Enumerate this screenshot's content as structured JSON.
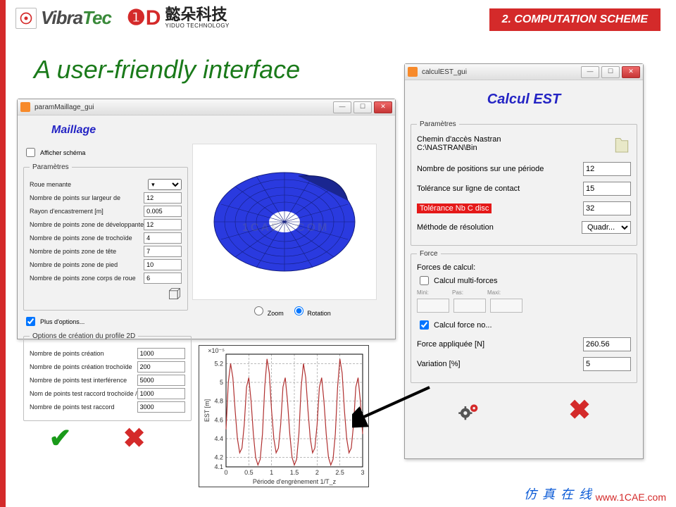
{
  "header": {
    "brand_a_dark": "Vibra",
    "brand_a_green": "Tec",
    "brand_b_cn": "懿朵科技",
    "brand_b_en": "YIDUO TECHNOLOGY",
    "scheme_label": "2. COMPUTATION SCHEME"
  },
  "slide_title": "A user-friendly interface",
  "win_maillage": {
    "title": "paramMaillage_gui",
    "heading": "Maillage",
    "cb_afficher": "Afficher schéma",
    "fs_params": "Paramètres",
    "roue_label": "Roue menante",
    "fields": [
      {
        "label": "Nombre de points sur largeur de",
        "value": "12"
      },
      {
        "label": "Rayon d'encastrement [m]",
        "value": "0.005"
      },
      {
        "label": "Nombre de points zone de développante",
        "value": "12"
      },
      {
        "label": "Nombre de points zone de trochoïde",
        "value": "4"
      },
      {
        "label": "Nombre de points zone de tête",
        "value": "7"
      },
      {
        "label": "Nombre de points zone de pied",
        "value": "10"
      },
      {
        "label": "Nombre de points zone corps de roue",
        "value": "6"
      }
    ],
    "cb_plus": "Plus d'options...",
    "fs_options": "Options de création du profile 2D",
    "fields2": [
      {
        "label": "Nombre de points création",
        "value": "1000"
      },
      {
        "label": "Nombre de points création trochoïde",
        "value": "200"
      },
      {
        "label": "Nombre de points test interférence",
        "value": "5000"
      },
      {
        "label": "Nom de points test raccord trochoïde /",
        "value": "1000"
      },
      {
        "label": "Nombre de points test raccord",
        "value": "3000"
      }
    ],
    "radio_zoom": "Zoom",
    "radio_rotation": "Rotation"
  },
  "win_calc": {
    "title": "calculEST_gui",
    "heading": "Calcul EST",
    "fs_params": "Paramètres",
    "chemin_l1": "Chemin d'accès Nastran",
    "chemin_l2": "C:\\NASTRAN\\Bin",
    "f_positions_label": "Nombre de positions sur une période",
    "f_positions_value": "12",
    "f_tol_label": "Tolérance sur ligne de contact",
    "f_tol_value": "15",
    "f_tol_nb_label": "Tolérance Nb C disc",
    "f_tol_nb_value": "32",
    "f_method_label": "Méthode de résolution",
    "f_method_value": "Quadr...",
    "fs_force": "Force",
    "forces_heading": "Forces de calcul:",
    "cb_multi": "Calcul multi-forces",
    "mini": "Mini:",
    "pas": "Pas:",
    "maxi": "Maxi:",
    "cb_force_no": "Calcul force no...",
    "force_app_label": "Force appliquée [N]",
    "force_app_value": "260.56",
    "var_label": "Variation [%]",
    "var_value": "5"
  },
  "chart_data": {
    "type": "line",
    "title": "",
    "xlabel": "Période d'engrènement 1/T_z",
    "ylabel": "EST [m]",
    "y_exponent": "×10⁻⁵",
    "xlim": [
      0,
      3
    ],
    "ylim": [
      4.1,
      5.3
    ],
    "xticks": [
      0,
      0.5,
      1,
      1.5,
      2,
      2.5,
      3
    ],
    "yticks": [
      4.1,
      4.2,
      4.4,
      4.6,
      4.8,
      5.0,
      5.2
    ],
    "x": [
      0.0,
      0.05,
      0.1,
      0.15,
      0.2,
      0.25,
      0.3,
      0.35,
      0.4,
      0.45,
      0.5,
      0.55,
      0.6,
      0.65,
      0.7,
      0.75,
      0.8,
      0.85,
      0.9,
      0.95,
      1.0,
      1.05,
      1.1,
      1.15,
      1.2,
      1.25,
      1.3,
      1.35,
      1.4,
      1.45,
      1.5,
      1.55,
      1.6,
      1.65,
      1.7,
      1.75,
      1.8,
      1.85,
      1.9,
      1.95,
      2.0,
      2.05,
      2.1,
      2.15,
      2.2,
      2.25,
      2.3,
      2.35,
      2.4,
      2.45,
      2.5,
      2.55,
      2.6,
      2.65,
      2.7,
      2.75,
      2.8,
      2.85,
      2.9,
      2.95,
      3.0
    ],
    "y": [
      4.5,
      5.0,
      5.2,
      5.05,
      4.7,
      4.4,
      4.25,
      4.3,
      4.55,
      4.95,
      5.05,
      4.8,
      4.45,
      4.2,
      4.12,
      4.18,
      4.45,
      4.95,
      5.25,
      5.1,
      4.7,
      4.4,
      4.25,
      4.3,
      4.55,
      4.95,
      5.05,
      4.8,
      4.45,
      4.2,
      4.12,
      4.18,
      4.45,
      4.95,
      5.2,
      5.05,
      4.7,
      4.4,
      4.25,
      4.3,
      4.55,
      4.95,
      5.05,
      4.8,
      4.45,
      4.2,
      4.12,
      4.18,
      4.45,
      4.95,
      5.25,
      5.1,
      4.7,
      4.4,
      4.25,
      4.3,
      4.55,
      4.95,
      5.05,
      4.8,
      4.45
    ]
  },
  "watermark": "1CAE . COM",
  "footer": {
    "cn": "仿真在线",
    "url": "www.1CAE.com"
  }
}
